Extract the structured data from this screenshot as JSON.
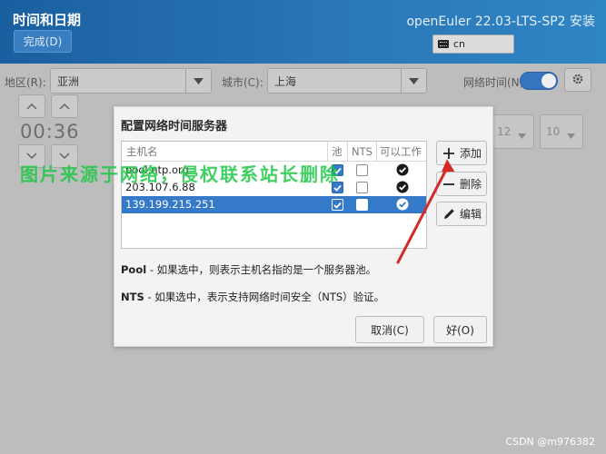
{
  "header": {
    "page_title": "时间和日期",
    "done_label": "完成(D)",
    "product_title": "openEuler 22.03-LTS-SP2 安装",
    "keyboard_layout": "cn"
  },
  "form": {
    "region_label": "地区(R):",
    "region_value": "亚洲",
    "city_label": "城市(C):",
    "city_value": "上海",
    "network_time_label": "网络时间(N)",
    "network_time_on": true,
    "time_value": "00:36",
    "date_fields": [
      "12",
      "10"
    ]
  },
  "dialog": {
    "title": "配置网络时间服务器",
    "columns": {
      "host": "主机名",
      "pool": "池",
      "nts": "NTS",
      "usable": "可以工作"
    },
    "rows": [
      {
        "host": "pool.ntp.org",
        "pool": true,
        "nts": false,
        "usable": true,
        "selected": false
      },
      {
        "host": "203.107.6.88",
        "pool": true,
        "nts": false,
        "usable": true,
        "selected": false
      },
      {
        "host": "139.199.215.251",
        "pool": true,
        "nts": false,
        "usable": true,
        "selected": true
      }
    ],
    "add_label": "添加",
    "remove_label": "删除",
    "edit_label": "编辑",
    "pool_note_key": "Pool",
    "pool_note_text": " - 如果选中，则表示主机名指的是一个服务器池。",
    "nts_note_key": "NTS",
    "nts_note_text": " - 如果选中，表示支持网络时间安全（NTS）验证。",
    "cancel_label": "取消(C)",
    "ok_label": "好(O)"
  },
  "overlay": {
    "watermark": "图片来源于网络，侵权联系站长删除",
    "credit": "CSDN @m976382"
  },
  "colors": {
    "header_blue": "#2a76b8",
    "selection_blue": "#3579c9",
    "annotation_red": "#d42a2a",
    "watermark_green": "#1ec846"
  }
}
